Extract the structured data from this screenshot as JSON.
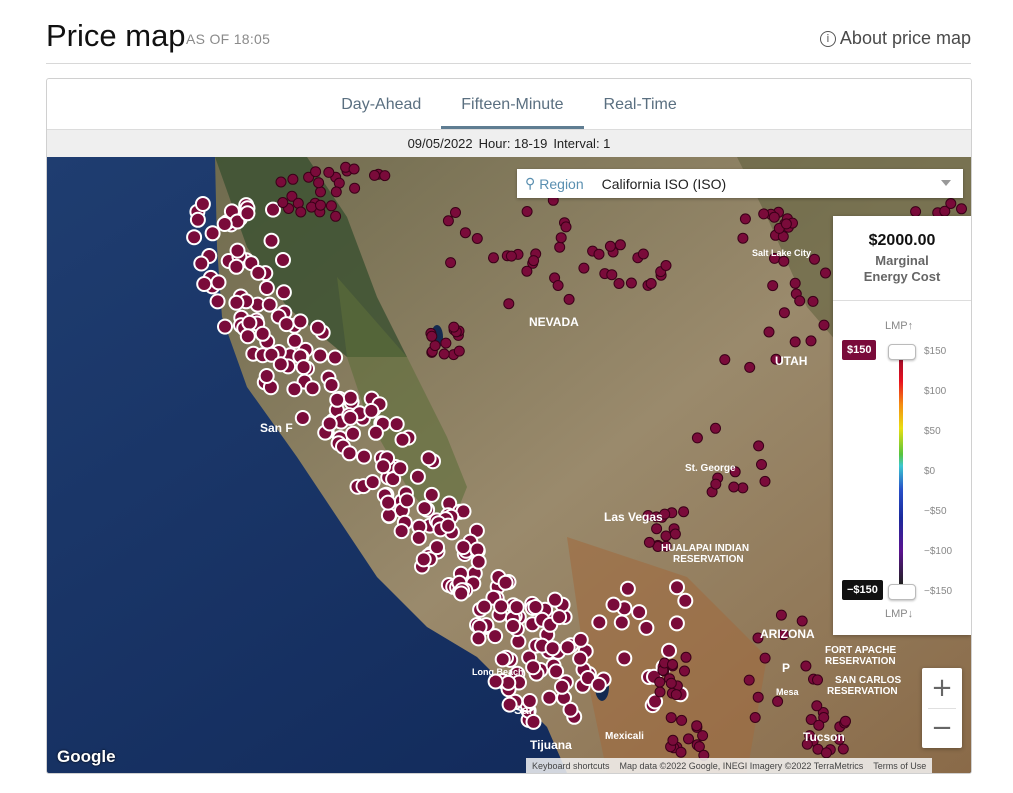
{
  "header": {
    "title": "Price map",
    "as_of": "AS OF 18:05",
    "about": "About price map",
    "info_glyph": "i"
  },
  "tabs": [
    {
      "label": "Day-Ahead"
    },
    {
      "label": "Fifteen-Minute",
      "active": true
    },
    {
      "label": "Real-Time"
    }
  ],
  "interval": {
    "date": "09/05/2022",
    "hour": "Hour: 18-19",
    "interval": "Interval: 1"
  },
  "region": {
    "label": "Region",
    "value": "California ISO (ISO)",
    "icon": "map-pin-icon"
  },
  "legend": {
    "price": "$2000.00",
    "desc1": "Marginal",
    "desc2": "Energy Cost",
    "lmp_up": "LMP↑",
    "lmp_down": "LMP↓",
    "max_badge": "$150",
    "min_badge": "−$150",
    "ticks": [
      "$150",
      "$100",
      "$50",
      "$0",
      "−$50",
      "−$100",
      "−$150"
    ]
  },
  "zoom": {
    "in": "+",
    "out": "−"
  },
  "map_labels": {
    "nevada": "NEVADA",
    "utah": "UTAH",
    "arizona": "ARIZONA",
    "san_francisco": "San F",
    "las_vegas": "Las Vegas",
    "st_george": "St. George",
    "hualapai": "HUALAPAI INDIAN",
    "reservation": "RESERVATION",
    "fort_apache": "FORT APACHE",
    "fort_apache2": "RESERVATION",
    "san_carlos": "SAN CARLOS",
    "san_carlos2": "RESERVATION",
    "salt_lake": "Salt Lake City",
    "long_beach": "Long Beach",
    "san_diego": "San",
    "tijuana": "Tijuana",
    "mexicali": "Mexicali",
    "tucson": "Tucson",
    "phoenix": "P",
    "mesa": "Mesa"
  },
  "map_footer": {
    "google": "Google",
    "shortcuts": "Keyboard shortcuts",
    "mapdata": "Map data ©2022 Google, INEGI Imagery ©2022 TerraMetrics",
    "terms": "Terms of Use"
  },
  "colors": {
    "node": "#7a0b3a",
    "tab_accent": "#5f7d92"
  }
}
